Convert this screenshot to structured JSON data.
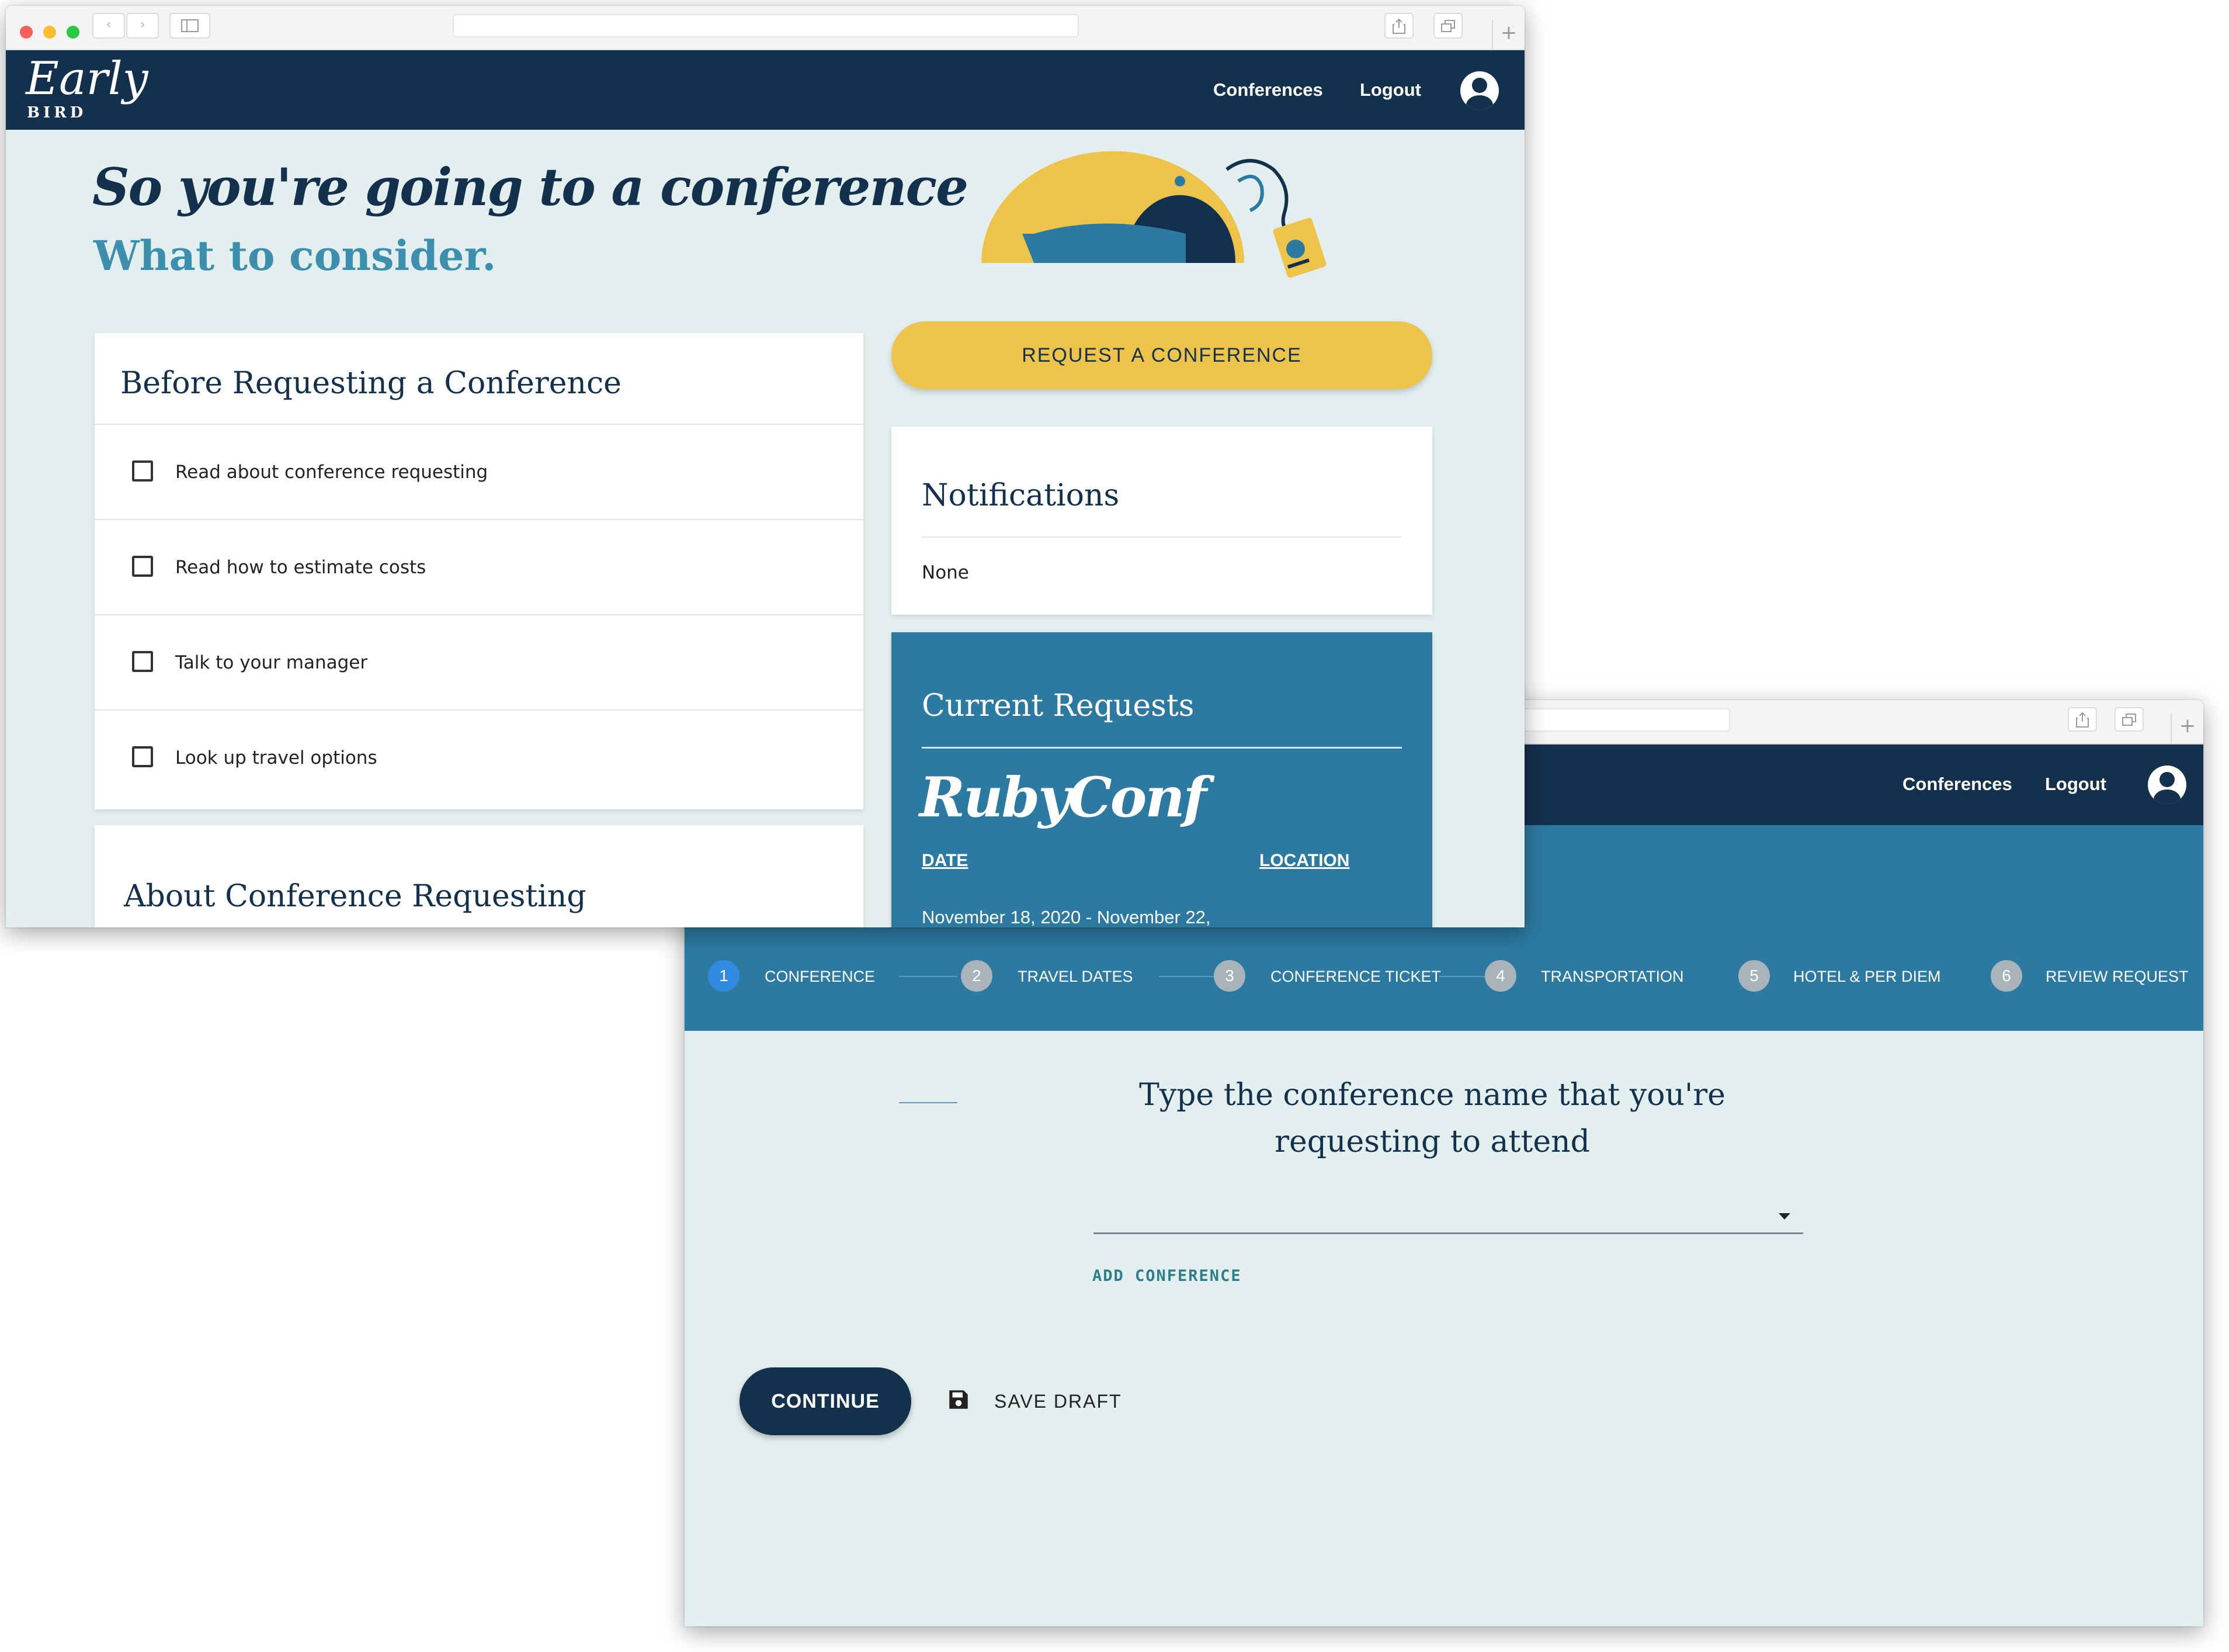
{
  "colors": {
    "navy": "#13304d",
    "mint": "#e3efee",
    "yellow": "#eec34a",
    "steel_blue": "#2c7aa2",
    "link_teal": "#3d8fae",
    "step_active": "#2f8ae0"
  },
  "dashboard": {
    "logo": {
      "early": "Early",
      "bird": "BIRD"
    },
    "nav": {
      "conferences": "Conferences",
      "logout": "Logout",
      "account_icon": "account-circle-icon"
    },
    "hero": {
      "title": "So you're going to a conference",
      "subtitle": "What to consider."
    },
    "checklist": {
      "title": "Before Requesting a Conference",
      "items": [
        {
          "label": "Read about conference requesting",
          "checked": false
        },
        {
          "label": "Read how to estimate costs",
          "checked": false
        },
        {
          "label": "Talk to your manager",
          "checked": false
        },
        {
          "label": "Look up travel options",
          "checked": false
        }
      ]
    },
    "about": {
      "title": "About Conference Requesting"
    },
    "request_button": "REQUEST A CONFERENCE",
    "notifications": {
      "title": "Notifications",
      "body": "None"
    },
    "current_requests": {
      "title": "Current Requests",
      "conference_name": "RubyConf",
      "date_header": "DATE",
      "location_header": "LOCATION",
      "date_value": "November 18, 2020 - November 22,"
    }
  },
  "request_form": {
    "nav": {
      "conferences": "Conferences",
      "logout": "Logout",
      "account_icon": "account-circle-icon"
    },
    "steps": [
      {
        "number": "1",
        "label": "CONFERENCE",
        "active": true
      },
      {
        "number": "2",
        "label": "TRAVEL DATES",
        "active": false
      },
      {
        "number": "3",
        "label": "CONFERENCE TICKET",
        "active": false
      },
      {
        "number": "4",
        "label": "TRANSPORTATION",
        "active": false
      },
      {
        "number": "5",
        "label": "HOTEL & PER DIEM",
        "active": false
      },
      {
        "number": "6",
        "label": "REVIEW REQUEST",
        "active": false
      }
    ],
    "prompt_line1": "Type the conference name that you're",
    "prompt_line2": "requesting to attend",
    "select_value": "",
    "add_conference": "ADD CONFERENCE",
    "continue": "CONTINUE",
    "save_draft": "SAVE DRAFT",
    "save_icon": "floppy-disk-icon"
  }
}
